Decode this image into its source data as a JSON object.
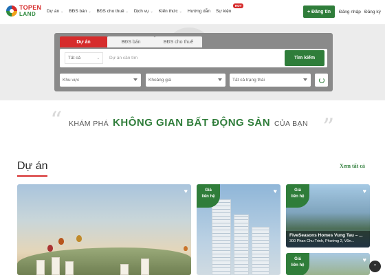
{
  "logo": {
    "line1": "TOPEN",
    "line2": "LAND"
  },
  "nav": [
    {
      "label": "Dự án",
      "chevron": true
    },
    {
      "label": "BĐS bán",
      "chevron": true
    },
    {
      "label": "BĐS cho thuê",
      "chevron": true
    },
    {
      "label": "Dịch vụ",
      "chevron": true
    },
    {
      "label": "Kiến thức",
      "chevron": true
    },
    {
      "label": "Hướng dẫn",
      "chevron": false
    },
    {
      "label": "Sự kiện",
      "chevron": false
    }
  ],
  "hot_badge": "HOT",
  "header": {
    "post_button": "+ Đăng tin",
    "login": "Đăng nhập",
    "register": "Đăng ký"
  },
  "search": {
    "tabs": [
      "Dự án",
      "BĐS bán",
      "BĐS cho thuê"
    ],
    "type_select": "Tất cả",
    "project_placeholder": "Dự án cần tìm",
    "search_button": "Tìm kiếm",
    "filters": [
      "Khu vực",
      "Khoảng giá",
      "Tất cả trạng thái"
    ]
  },
  "slogan": {
    "part1": "KHÁM PHÁ",
    "part2": "KHÔNG GIAN BẤT ĐỘNG SẢN",
    "part3": "CỦA BẠN"
  },
  "section": {
    "title": "Dự án",
    "see_all": "Xem tất cả"
  },
  "cards": [
    {
      "price_line1": "Giá",
      "price_line2": "liên hệ"
    },
    {
      "price_line1": "Giá",
      "price_line2": "liên hệ",
      "name": "FiveSeasons Homes Vung Tau – ...",
      "address": "300 Phan Chu Trinh, Phường 2, Vũn..."
    },
    {
      "price_line1": "Giá",
      "price_line2": "liên hệ"
    }
  ],
  "colors": {
    "brand_green": "#2f7d3a",
    "brand_red": "#d62c2c"
  },
  "icons": {
    "heart": "heart-icon",
    "scroll_top": "chevron-up-icon",
    "reset": "refresh-icon"
  }
}
